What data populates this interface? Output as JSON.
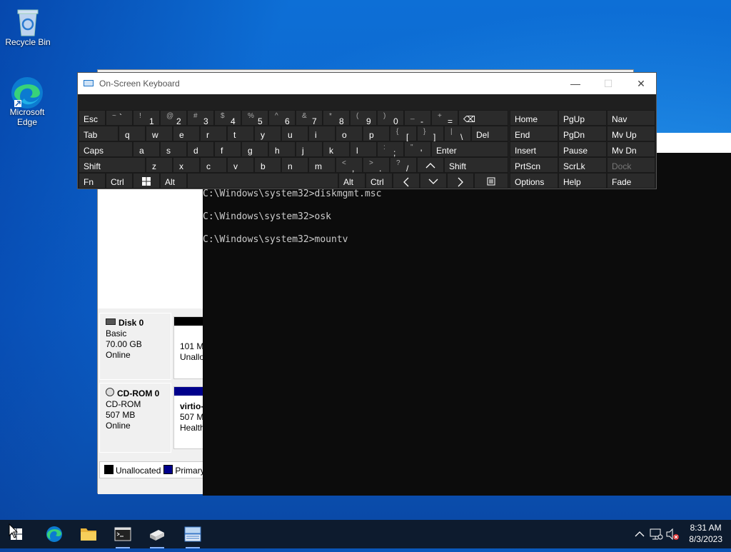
{
  "desktop": {
    "icons": [
      {
        "label": "Recycle Bin"
      },
      {
        "label": "Microsoft Edge"
      }
    ]
  },
  "disk_mgmt": {
    "disks": [
      {
        "name": "Disk 0",
        "type": "Basic",
        "size": "70.00 GB",
        "status": "Online",
        "partition_size": "101 MI",
        "partition_status": "Unallo",
        "bar_color": "#000000"
      },
      {
        "name": "CD-ROM 0",
        "type": "CD-ROM",
        "size": "507 MB",
        "status": "Online",
        "partition_name": "virtio-",
        "partition_size": "507 MI",
        "partition_status": "Health",
        "bar_color": "#00008b"
      }
    ],
    "legend": [
      {
        "label": "Unallocated",
        "color": "#000000"
      },
      {
        "label": "Primary",
        "color": "#00008b"
      }
    ]
  },
  "cmd": {
    "lines": [
      "C:\\Windows\\system32>diskmgmt.msc",
      "C:\\Windows\\system32>osk",
      "C:\\Windows\\system32>mountv"
    ]
  },
  "osk": {
    "title": "On-Screen Keyboard",
    "window_buttons": {
      "minimize": "—",
      "maximize": "☐",
      "close": "✕"
    },
    "row1": {
      "esc": "Esc",
      "keys": [
        {
          "sym": "~",
          "ch": "`"
        },
        {
          "sym": "!",
          "ch": "1"
        },
        {
          "sym": "@",
          "ch": "2"
        },
        {
          "sym": "#",
          "ch": "3"
        },
        {
          "sym": "$",
          "ch": "4"
        },
        {
          "sym": "%",
          "ch": "5"
        },
        {
          "sym": "^",
          "ch": "6"
        },
        {
          "sym": "&",
          "ch": "7"
        },
        {
          "sym": "*",
          "ch": "8"
        },
        {
          "sym": "(",
          "ch": "9"
        },
        {
          "sym": ")",
          "ch": "0"
        },
        {
          "sym": "_",
          "ch": "-"
        },
        {
          "sym": "+",
          "ch": "="
        }
      ],
      "backspace": "⌫"
    },
    "row2": {
      "tab": "Tab",
      "letters": [
        "q",
        "w",
        "e",
        "r",
        "t",
        "y",
        "u",
        "i",
        "o",
        "p"
      ],
      "brackets": [
        {
          "sym": "{",
          "ch": "["
        },
        {
          "sym": "}",
          "ch": "]"
        },
        {
          "sym": "|",
          "ch": "\\"
        }
      ],
      "del": "Del"
    },
    "row3": {
      "caps": "Caps",
      "letters": [
        "a",
        "s",
        "d",
        "f",
        "g",
        "h",
        "j",
        "k",
        "l"
      ],
      "punct": [
        {
          "sym": ":",
          "ch": ";"
        },
        {
          "sym": "\"",
          "ch": "'"
        }
      ],
      "enter": "Enter"
    },
    "row4": {
      "shift_left": "Shift",
      "letters": [
        "z",
        "x",
        "c",
        "v",
        "b",
        "n",
        "m"
      ],
      "punct": [
        {
          "sym": "<",
          "ch": ","
        },
        {
          "sym": ">",
          "ch": "."
        },
        {
          "sym": "?",
          "ch": "/"
        }
      ],
      "up": "^",
      "shift_right": "Shift"
    },
    "row5": {
      "fn": "Fn",
      "ctrl_left": "Ctrl",
      "win": "⊞",
      "alt_left": "Alt",
      "alt_right": "Alt",
      "ctrl_right": "Ctrl",
      "left": "<",
      "down": "v",
      "right": ">",
      "menu": "☰"
    },
    "nav": [
      [
        "Home",
        "PgUp",
        "Nav"
      ],
      [
        "End",
        "PgDn",
        "Mv Up"
      ],
      [
        "Insert",
        "Pause",
        "Mv Dn"
      ],
      [
        "PrtScn",
        "ScrLk",
        "Dock"
      ],
      [
        "Options",
        "Help",
        "Fade"
      ]
    ]
  },
  "taskbar": {
    "clock_time": "8:31 AM",
    "clock_date": "8/3/2023"
  }
}
